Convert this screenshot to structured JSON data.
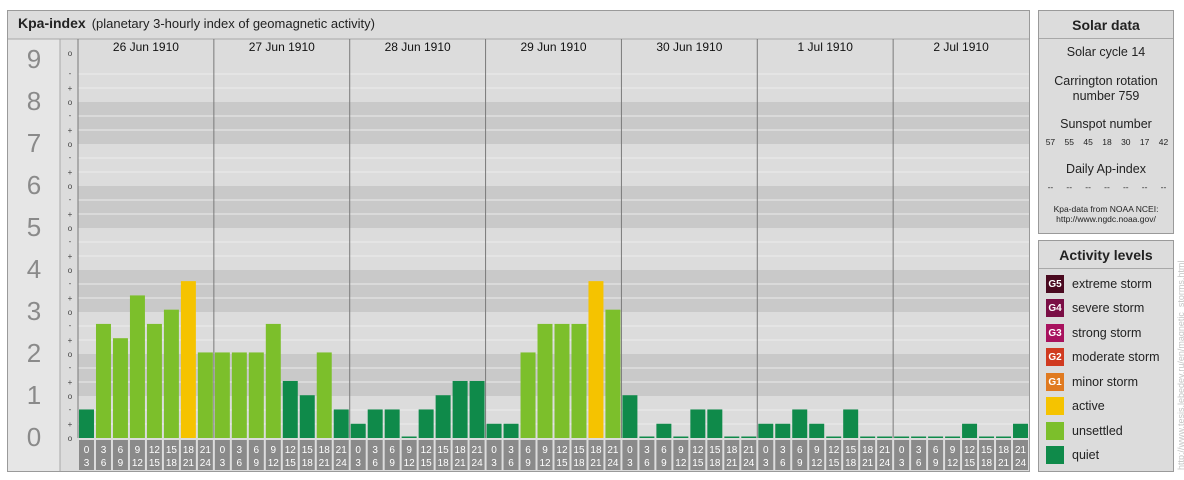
{
  "header": {
    "title": "Kpa-index",
    "subtitle": "(planetary 3-hourly index of geomagnetic activity)"
  },
  "chart_data": {
    "type": "bar",
    "title": "Kpa-index",
    "subtitle": "(planetary 3-hourly index of geomagnetic activity)",
    "ylim": [
      0,
      9
    ],
    "y_ticks": [
      "0",
      "1",
      "2",
      "3",
      "4",
      "5",
      "6",
      "7",
      "8",
      "9"
    ],
    "y_minor_labels": [
      "o",
      "+",
      "-"
    ],
    "days": [
      "26 Jun 1910",
      "27 Jun 1910",
      "28 Jun 1910",
      "29 Jun 1910",
      "30 Jun 1910",
      "1 Jul 1910",
      "2 Jul 1910"
    ],
    "interval_labels_top": [
      "0",
      "3",
      "6",
      "9",
      "12",
      "15",
      "18",
      "21"
    ],
    "interval_labels_bottom": [
      "3",
      "6",
      "9",
      "12",
      "15",
      "18",
      "21",
      "24"
    ],
    "series": [
      {
        "values": [
          0.667,
          2.667,
          2.333,
          3.333,
          2.667,
          3.0,
          3.667,
          2.0,
          2.0,
          2.0,
          2.0,
          2.667,
          1.333,
          1.0,
          2.0,
          0.667,
          0.333,
          0.667,
          0.667,
          0.0,
          0.667,
          1.0,
          1.333,
          1.333,
          0.333,
          0.333,
          2.0,
          2.667,
          2.667,
          2.667,
          3.667,
          3.0,
          1.0,
          0.0,
          0.333,
          0.0,
          0.667,
          0.667,
          0.0,
          0.0,
          0.333,
          0.333,
          0.667,
          0.333,
          0.0,
          0.667,
          0.0,
          0.0,
          0.0,
          0.0,
          0.0,
          0.0,
          0.333,
          0.0,
          0.0,
          0.333
        ]
      }
    ],
    "levels": [
      {
        "max": 1.834,
        "color": "#0f8a4a"
      },
      {
        "max": 3.5,
        "color": "#7cbf2b"
      },
      {
        "max": 4.5,
        "color": "#f5c300"
      },
      {
        "max": 5.5,
        "color": "#e07a20"
      },
      {
        "max": 6.5,
        "color": "#d03a20"
      },
      {
        "max": 7.5,
        "color": "#a8125e"
      },
      {
        "max": 8.5,
        "color": "#7a0e45"
      },
      {
        "max": 9.1,
        "color": "#4a0a20"
      }
    ],
    "grid": true
  },
  "solar": {
    "title": "Solar data",
    "cycle": "Solar cycle 14",
    "carrington_line1": "Carrington rotation",
    "carrington_line2": "number 759",
    "sunspot_label": "Sunspot number",
    "sunspot_values": [
      "57",
      "55",
      "45",
      "18",
      "30",
      "17",
      "42"
    ],
    "ap_label": "Daily Ap-index",
    "ap_values": [
      "--",
      "--",
      "--",
      "--",
      "--",
      "--",
      "--"
    ],
    "note_line1": "Kpa-data from NOAA NCEI:",
    "note_line2": "http://www.ngdc.noaa.gov/"
  },
  "activity": {
    "title": "Activity levels",
    "items": [
      {
        "code": "G5",
        "label": "extreme storm",
        "color": "#4a0a20"
      },
      {
        "code": "G4",
        "label": "severe storm",
        "color": "#7a0e45"
      },
      {
        "code": "G3",
        "label": "strong storm",
        "color": "#a8125e"
      },
      {
        "code": "G2",
        "label": "moderate storm",
        "color": "#d03a20"
      },
      {
        "code": "G1",
        "label": "minor storm",
        "color": "#e07a20"
      },
      {
        "code": "",
        "label": "active",
        "color": "#f5c300"
      },
      {
        "code": "",
        "label": "unsettled",
        "color": "#7cbf2b"
      },
      {
        "code": "",
        "label": "quiet",
        "color": "#0f8a4a"
      }
    ]
  },
  "watermark": "http://www.tesis.lebedev.ru/en/magnetic_storms.html"
}
